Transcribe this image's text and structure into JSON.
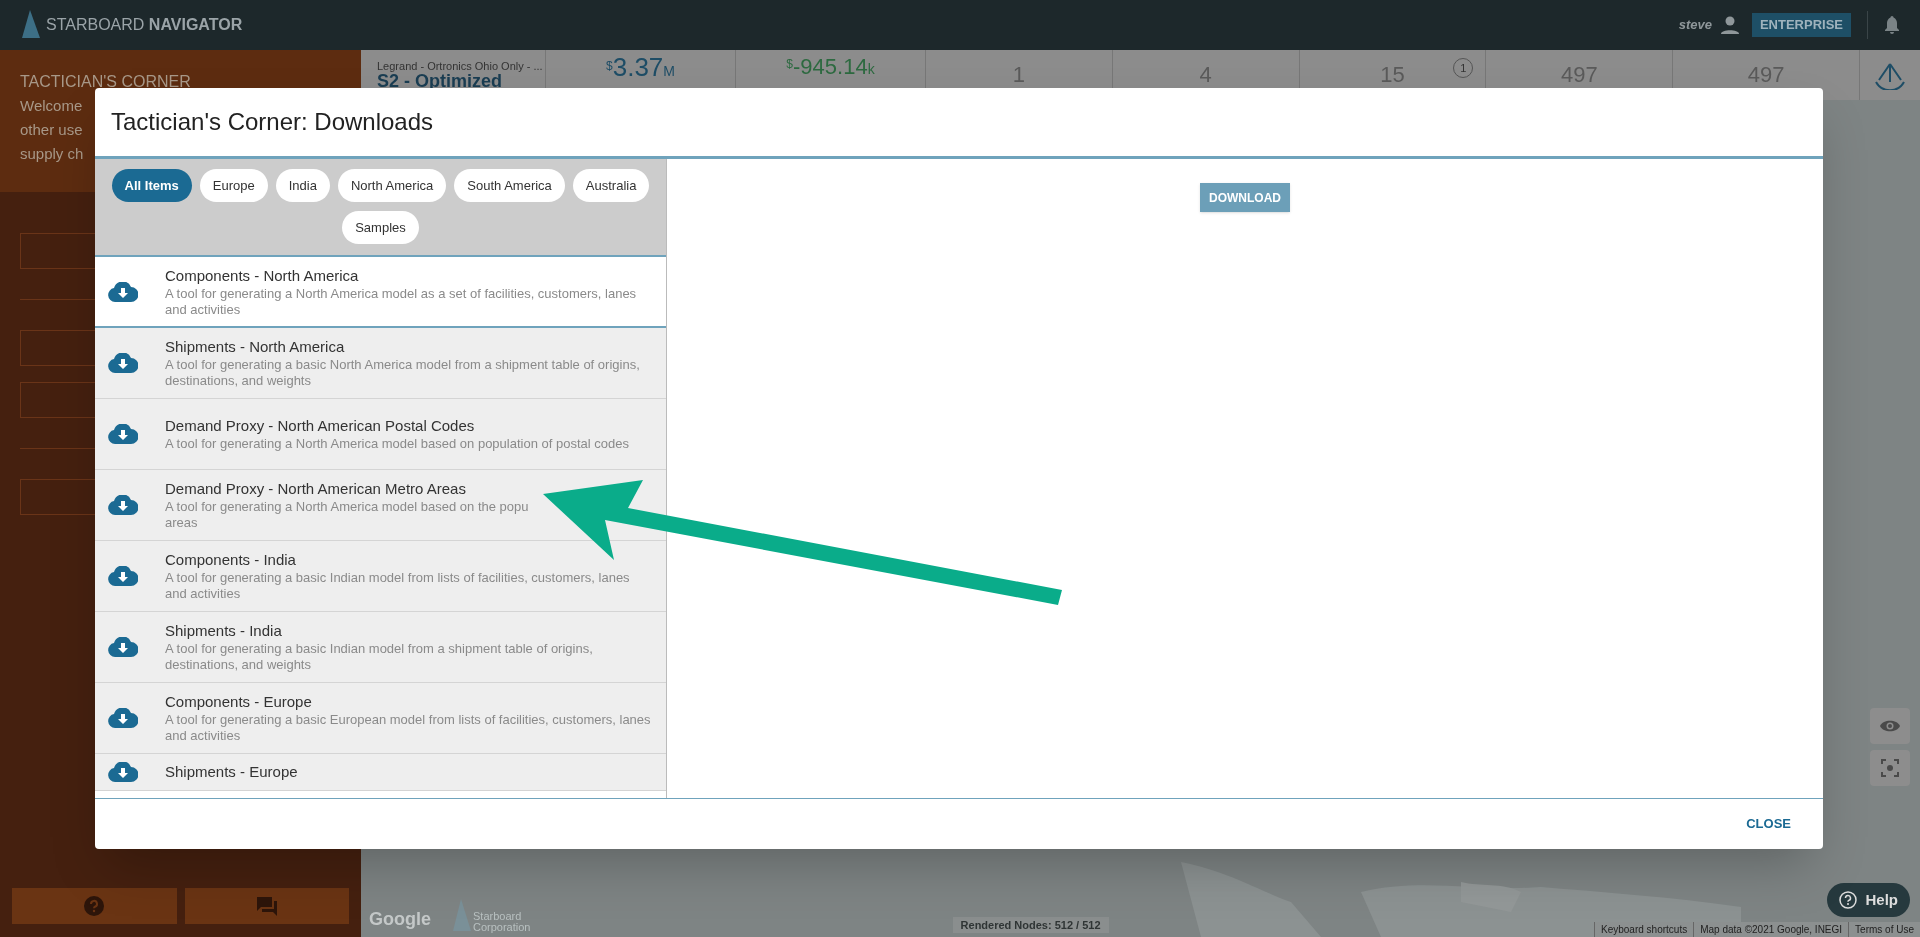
{
  "top_bar": {
    "brand_light": "STARBOARD",
    "brand_bold": "NAVIGATOR",
    "user": "steve",
    "plan": "ENTERPRISE"
  },
  "sidebar": {
    "title": "TACTICIAN'S CORNER",
    "intro_lines": [
      "Welcome",
      "other use",
      "supply ch"
    ]
  },
  "stats_bar": {
    "scenario_caption": "Legrand - Ortronics Ohio Only - ...",
    "scenario_name": "S2 - Optimized",
    "money": [
      {
        "prefix": "$",
        "value": "3.37",
        "suffix": "M",
        "kind": "large"
      },
      {
        "prefix": "$",
        "value": "-945.14",
        "suffix": "k",
        "kind": "delta"
      }
    ],
    "counts": [
      {
        "value": "1"
      },
      {
        "value": "4"
      },
      {
        "value": "15",
        "badge": "1"
      },
      {
        "value": "497"
      },
      {
        "value": "497"
      }
    ]
  },
  "map": {
    "attribution": "Google",
    "company_lines": [
      "Starboard",
      "Corporation"
    ],
    "rendered_nodes": "Rendered Nodes: 512 / 512",
    "footer_links": [
      "Keyboard shortcuts",
      "Map data ©2021 Google, INEGI",
      "Terms of Use"
    ],
    "help": "Help"
  },
  "dialog": {
    "title": "Tactician's Corner: Downloads",
    "filters": [
      {
        "label": "All Items",
        "selected": true
      },
      {
        "label": "Europe",
        "selected": false
      },
      {
        "label": "India",
        "selected": false
      },
      {
        "label": "North America",
        "selected": false
      },
      {
        "label": "South America",
        "selected": false
      },
      {
        "label": "Australia",
        "selected": false
      },
      {
        "label": "Samples",
        "selected": false
      }
    ],
    "items": [
      {
        "title": "Components - North America",
        "description": "A tool for generating a North America model as a set of facilities, customers, lanes and activities",
        "selected": true
      },
      {
        "title": "Shipments - North America",
        "description": "A tool for generating a basic North America model from a shipment table of origins, destinations, and weights",
        "selected": false
      },
      {
        "title": "Demand Proxy - North American Postal Codes",
        "description": "A tool for generating a North America model based on population of postal codes",
        "selected": false
      },
      {
        "title": "Demand Proxy - North American Metro Areas",
        "description": "A tool for generating a North America model based on the popu",
        "description_end": "areas",
        "selected": false
      },
      {
        "title": "Components - India",
        "description": "A tool for generating a basic Indian model from lists of facilities, customers, lanes and activities",
        "selected": false
      },
      {
        "title": "Shipments - India",
        "description": "A tool for generating a basic Indian model from a shipment table of origins, destinations, and weights",
        "selected": false
      },
      {
        "title": "Components - Europe",
        "description": "A tool for generating a basic European model from lists of facilities, customers, lanes and activities",
        "selected": false
      },
      {
        "title": "Shipments - Europe",
        "selected": false
      }
    ],
    "download": "DOWNLOAD",
    "close": "CLOSE"
  }
}
